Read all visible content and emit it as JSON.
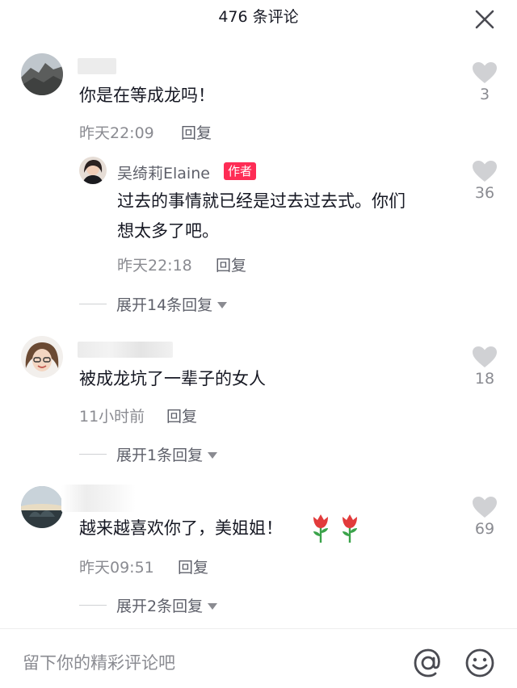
{
  "header": {
    "title": "476 条评论"
  },
  "comments": [
    {
      "text": "你是在等成龙吗！",
      "time": "昨天22:09",
      "reply_label": "回复",
      "likes": "3",
      "author_reply": {
        "username": "吴绮莉Elaine",
        "badge": "作者",
        "text_line1": "过去的事情就已经是过去过去式。你们",
        "text_line2": "想太多了吧。",
        "time": "昨天22:18",
        "reply_label": "回复",
        "likes": "36"
      },
      "expand_label": "展开14条回复"
    },
    {
      "text": "被成龙坑了一辈子的女人",
      "time": "11小时前",
      "reply_label": "回复",
      "likes": "18",
      "expand_label": "展开1条回复"
    },
    {
      "text": "越来越喜欢你了，美姐姐！",
      "time": "昨天09:51",
      "reply_label": "回复",
      "likes": "69",
      "expand_label": "展开2条回复"
    }
  ],
  "input": {
    "placeholder": "留下你的精彩评论吧"
  },
  "colors": {
    "accent": "#fe2c55",
    "text": "#161823",
    "muted": "#8a8b91",
    "heart": "#d0d1d4"
  },
  "icons": {
    "close": "close-icon",
    "like": "heart-icon",
    "at": "at-icon",
    "emoji": "emoji-icon",
    "rose": "rose-emoji"
  }
}
